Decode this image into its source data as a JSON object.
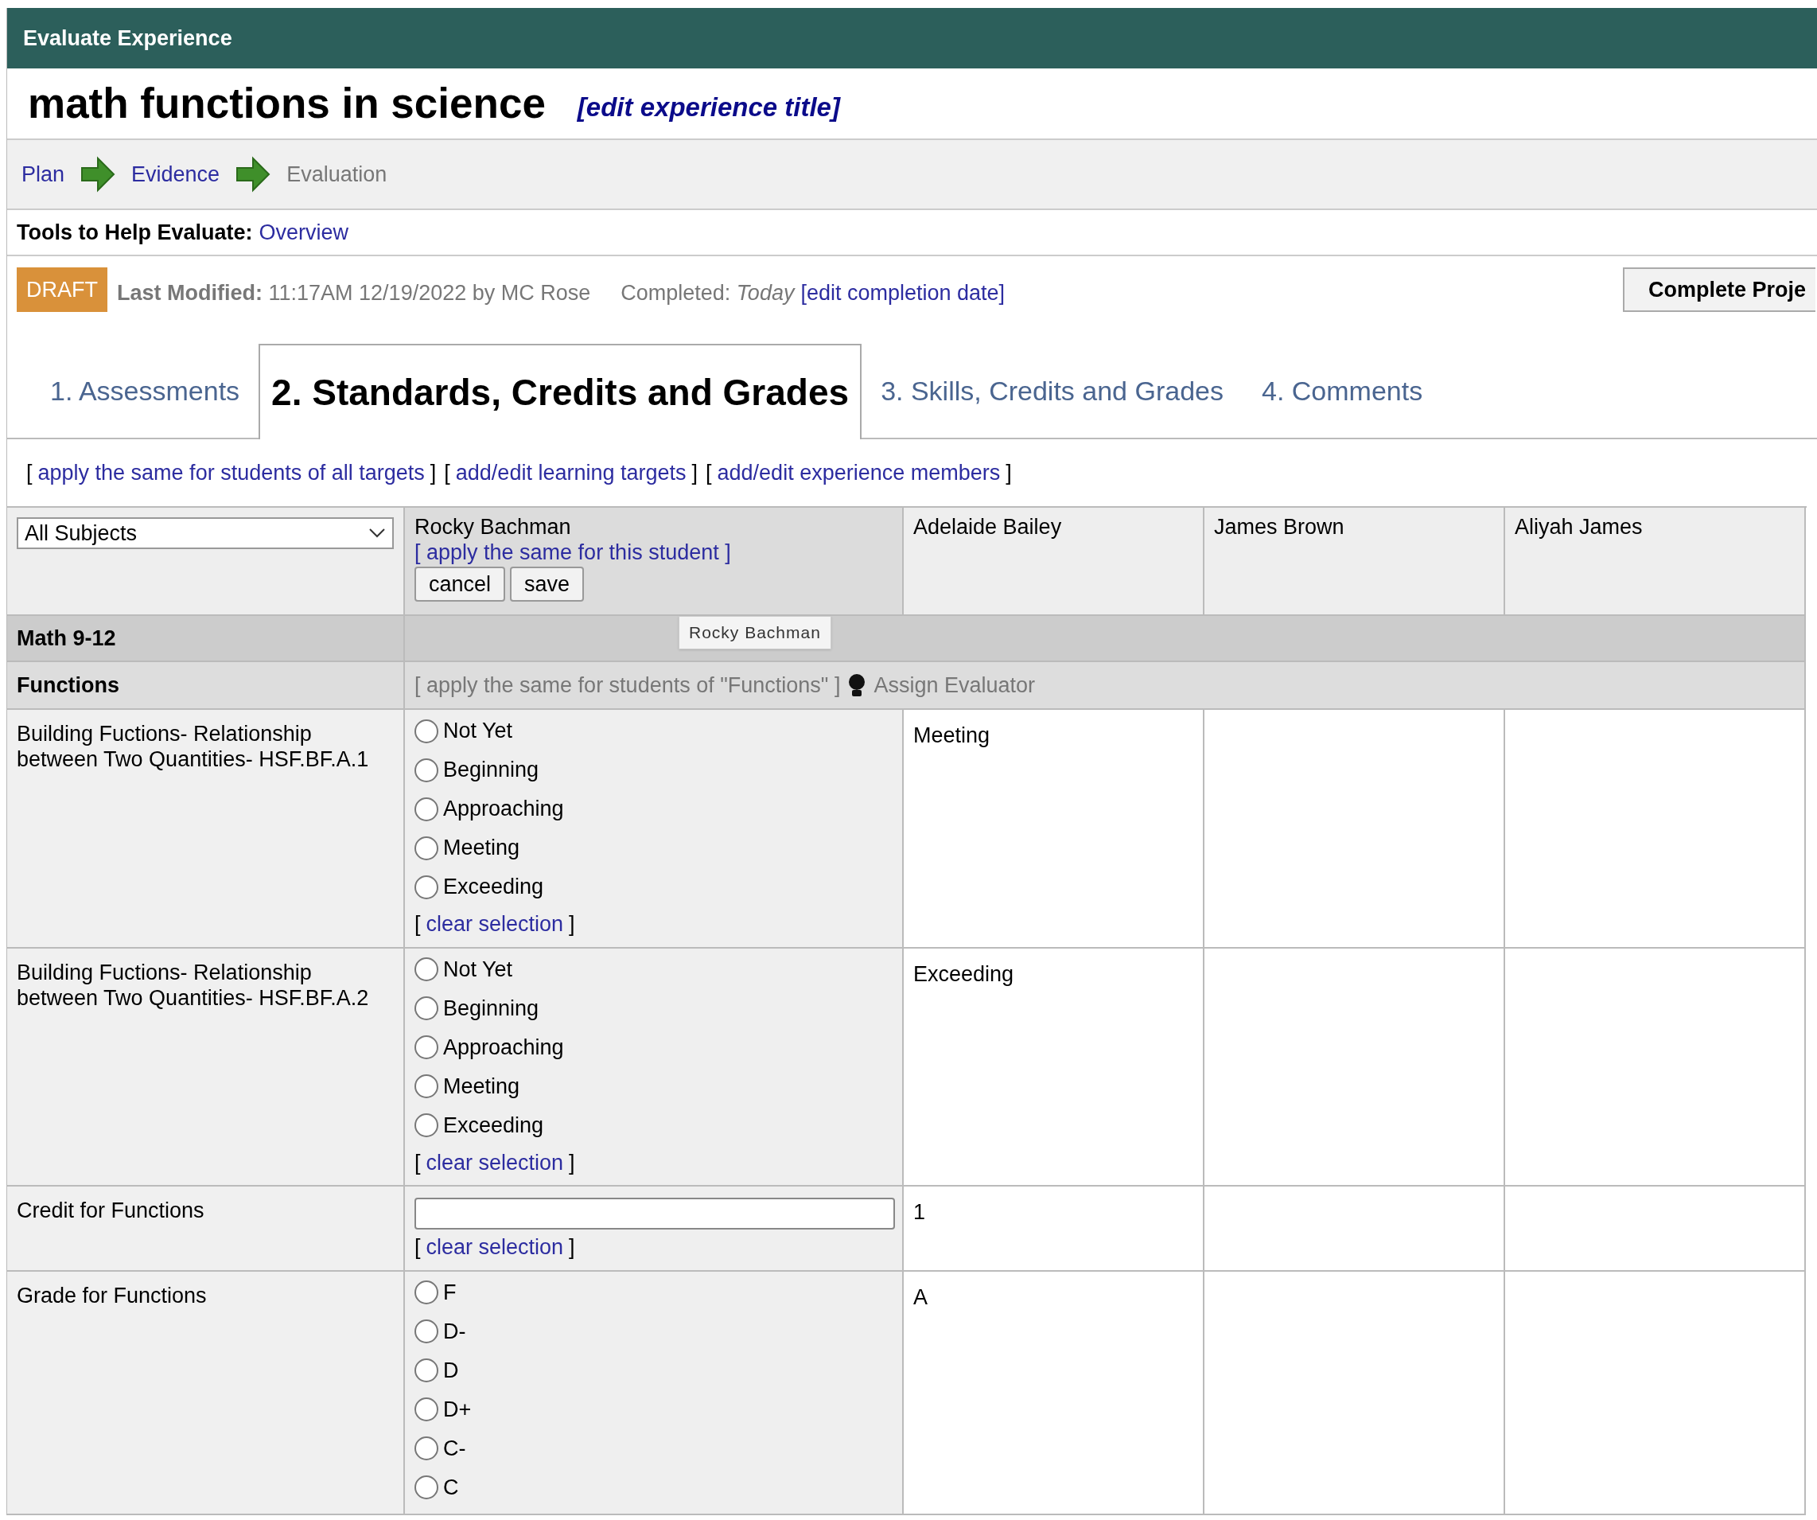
{
  "header": {
    "title": "Evaluate Experience"
  },
  "experience": {
    "title": "math functions in science",
    "edit_link": "[edit experience title]"
  },
  "steps": [
    {
      "label": "Plan",
      "current": false
    },
    {
      "label": "Evidence",
      "current": false
    },
    {
      "label": "Evaluation",
      "current": true
    }
  ],
  "tools": {
    "label": "Tools to Help Evaluate:",
    "link": "Overview"
  },
  "status": {
    "badge": "DRAFT",
    "modified_label": "Last Modified:",
    "modified_value": "11:17AM 12/19/2022 by MC Rose",
    "completed_label": "Completed:",
    "completed_value": "Today",
    "edit_link": "[edit completion date]",
    "button": "Complete Proje"
  },
  "tabs": [
    {
      "label": "1. Assessments",
      "selected": false
    },
    {
      "label": "2. Standards, Credits and Grades",
      "selected": true
    },
    {
      "label": "3. Skills, Credits and Grades",
      "selected": false
    },
    {
      "label": "4. Comments",
      "selected": false
    }
  ],
  "links": [
    {
      "open": "[",
      "label": "apply the same for students of all targets",
      "close": "]"
    },
    {
      "open": "[",
      "label": "add/edit learning targets",
      "close": "]"
    },
    {
      "open": "[",
      "label": "add/edit experience members",
      "close": "]"
    }
  ],
  "table": {
    "subject_select": "All Subjects",
    "students": [
      {
        "name": "Rocky Bachman",
        "editing": true,
        "apply_link": "[ apply the same for this student ]",
        "buttons": [
          "cancel",
          "save"
        ]
      },
      {
        "name": "Adelaide Bailey",
        "editing": false
      },
      {
        "name": "James Brown",
        "editing": false
      },
      {
        "name": "Aliyah James",
        "editing": false
      }
    ],
    "group": "Math 9-12",
    "tooltip": "Rocky Bachman",
    "section": {
      "label": "Functions",
      "apply_link": "[ apply the same for students of \"Functions\" ]",
      "assign": "Assign Evaluator"
    },
    "rows": [
      {
        "kind": "radio",
        "label": "Building Fuctions- Relationship between Two Quantities- HSF.BF.A.1",
        "options": [
          {
            "label": "Not Yet",
            "selected": false
          },
          {
            "label": "Beginning",
            "selected": false
          },
          {
            "label": "Approaching",
            "selected": false
          },
          {
            "label": "Meeting",
            "selected": false
          },
          {
            "label": "Exceeding",
            "selected": false
          }
        ],
        "clear": {
          "open": "[",
          "label": "clear selection",
          "close": "]"
        },
        "values": [
          "Meeting"
        ]
      },
      {
        "kind": "radio",
        "label": "Building Fuctions- Relationship between Two Quantities- HSF.BF.A.2",
        "options": [
          {
            "label": "Not Yet",
            "selected": false
          },
          {
            "label": "Beginning",
            "selected": false
          },
          {
            "label": "Approaching",
            "selected": false
          },
          {
            "label": "Meeting",
            "selected": false
          },
          {
            "label": "Exceeding",
            "selected": false
          }
        ],
        "clear": {
          "open": "[",
          "label": "clear selection",
          "close": "]"
        },
        "values": [
          "Exceeding"
        ]
      },
      {
        "kind": "input",
        "label": "Credit for Functions",
        "clear": {
          "open": "[",
          "label": "clear selection",
          "close": "]"
        },
        "values": [
          "1"
        ]
      },
      {
        "kind": "radio",
        "label": "Grade for Functions",
        "options": [
          {
            "label": "F",
            "selected": false
          },
          {
            "label": "D-",
            "selected": false
          },
          {
            "label": "D",
            "selected": false
          },
          {
            "label": "D+",
            "selected": false
          },
          {
            "label": "C-",
            "selected": false
          },
          {
            "label": "C",
            "selected": false
          }
        ],
        "values": [
          "A"
        ]
      }
    ]
  }
}
